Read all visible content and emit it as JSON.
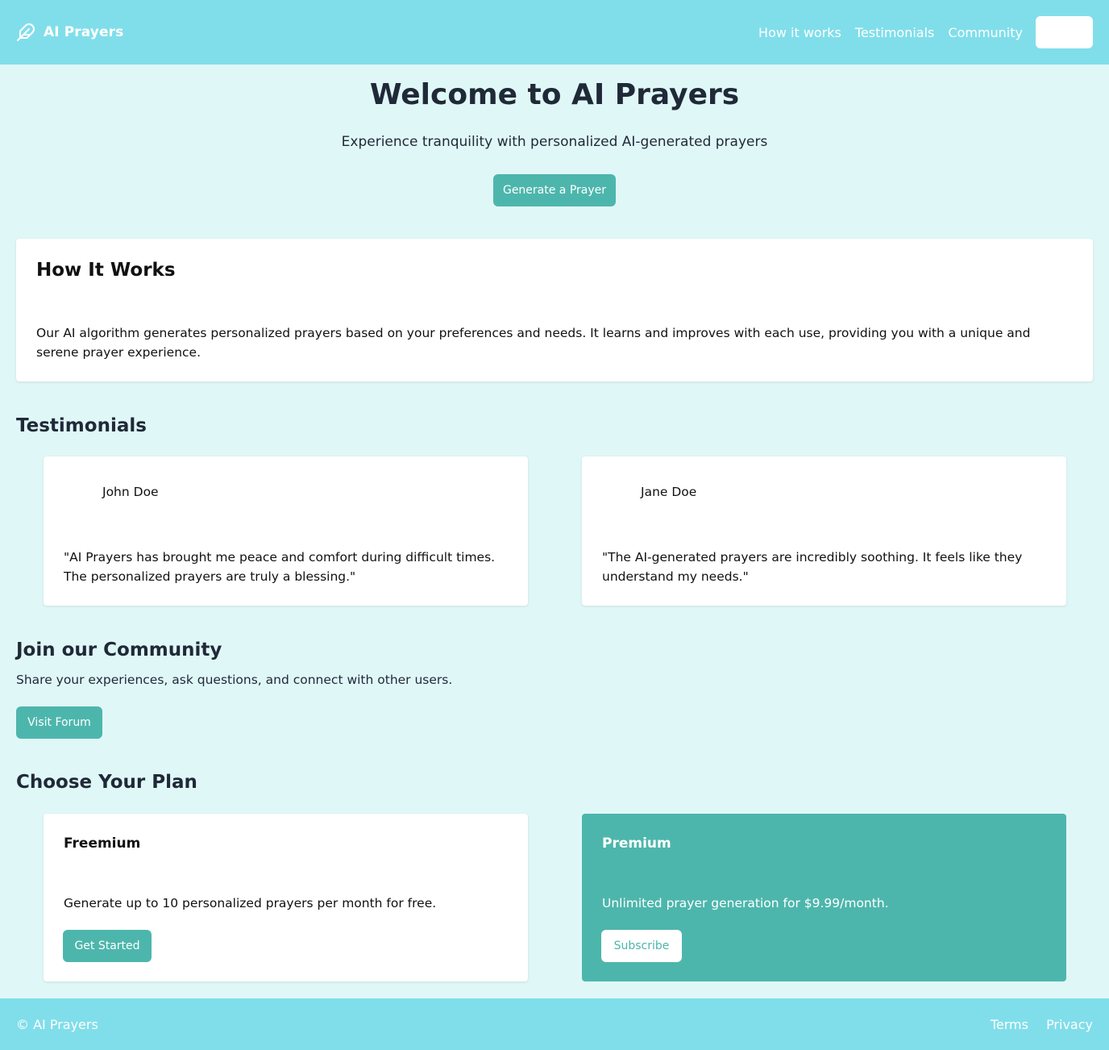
{
  "header": {
    "brand": "AI Prayers",
    "brand_icon": "feather-icon",
    "nav": [
      "How it works",
      "Testimonials",
      "Community"
    ],
    "nav_button_label": ""
  },
  "hero": {
    "title": "Welcome to AI Prayers",
    "subtitle": "Experience tranquility with personalized AI-generated prayers",
    "button": "Generate a Prayer"
  },
  "how_it_works": {
    "title": "How It Works",
    "text": "Our AI algorithm generates personalized prayers based on your preferences and needs. It learns and improves with each use, providing you with a unique and serene prayer experience."
  },
  "testimonials": {
    "title": "Testimonials",
    "items": [
      {
        "name": "John Doe",
        "quote": "\"AI Prayers has brought me peace and comfort during difficult times. The personalized prayers are truly a blessing.\""
      },
      {
        "name": "Jane Doe",
        "quote": "\"The AI-generated prayers are incredibly soothing. It feels like they understand my needs.\""
      }
    ]
  },
  "community": {
    "title": "Join our Community",
    "text": "Share your experiences, ask questions, and connect with other users.",
    "button": "Visit Forum"
  },
  "plans": {
    "title": "Choose Your Plan",
    "items": [
      {
        "name": "Freemium",
        "description": "Generate up to 10 personalized prayers per month for free.",
        "button": "Get Started"
      },
      {
        "name": "Premium",
        "description": "Unlimited prayer generation for $9.99/month.",
        "button": "Subscribe"
      }
    ]
  },
  "footer": {
    "copyright": "© AI Prayers",
    "links": [
      "Terms",
      "Privacy"
    ]
  },
  "colors": {
    "header_bg": "#80deea",
    "page_bg": "#e0f7f8",
    "accent": "#4db6ac",
    "text_dark": "#1f2937"
  }
}
